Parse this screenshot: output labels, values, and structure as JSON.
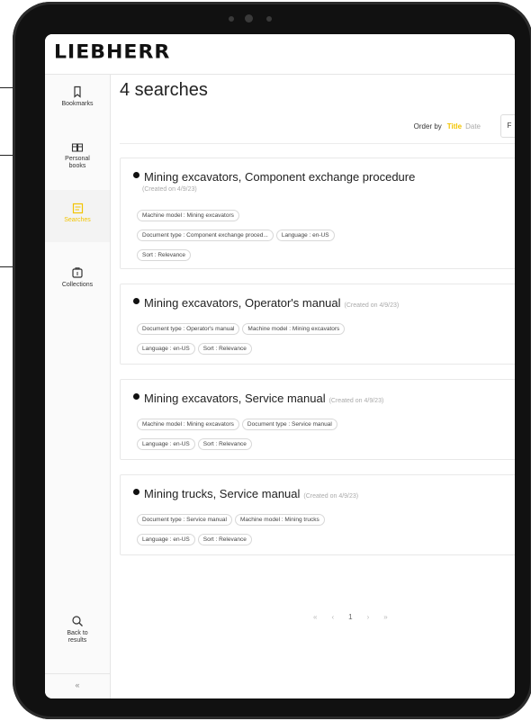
{
  "logo": "LIEBHERR",
  "sidebar": {
    "items": [
      {
        "label": "Bookmarks",
        "icon": "bookmark-icon"
      },
      {
        "label": "Personal books",
        "icon": "book-icon"
      },
      {
        "label": "Searches",
        "icon": "search-list-icon"
      },
      {
        "label": "Collections",
        "icon": "collections-icon"
      }
    ],
    "back_to_results": "Back to results",
    "collapse": "«"
  },
  "main": {
    "title": "4 searches",
    "order_by": {
      "label": "Order by",
      "selected": "Title",
      "other": "Date"
    },
    "filter_button": "F",
    "searches": [
      {
        "title": "Mining excavators, Component exchange procedure",
        "created": "(Created on 4/9/23)",
        "tags": [
          "Machine model : Mining excavators",
          "Document type : Component exchange proced...",
          "Language : en-US",
          "Sort : Relevance"
        ]
      },
      {
        "title": "Mining excavators, Operator's manual",
        "created": "(Created on 4/9/23)",
        "tags": [
          "Document type : Operator's manual",
          "Machine model : Mining excavators",
          "Language : en-US",
          "Sort : Relevance"
        ]
      },
      {
        "title": "Mining excavators, Service manual",
        "created": "(Created on 4/9/23)",
        "tags": [
          "Machine model : Mining excavators",
          "Document type : Service manual",
          "Language : en-US",
          "Sort : Relevance"
        ]
      },
      {
        "title": "Mining trucks, Service manual",
        "created": "(Created on 4/9/23)",
        "tags": [
          "Document type : Service manual",
          "Machine model : Mining trucks",
          "Language : en-US",
          "Sort : Relevance"
        ]
      }
    ],
    "pagination": {
      "first": "«",
      "prev": "‹",
      "current": "1",
      "next": "›",
      "last": "»"
    }
  },
  "colors": {
    "accent": "#f2c400",
    "text": "#222222",
    "muted": "#aaaaaa"
  }
}
